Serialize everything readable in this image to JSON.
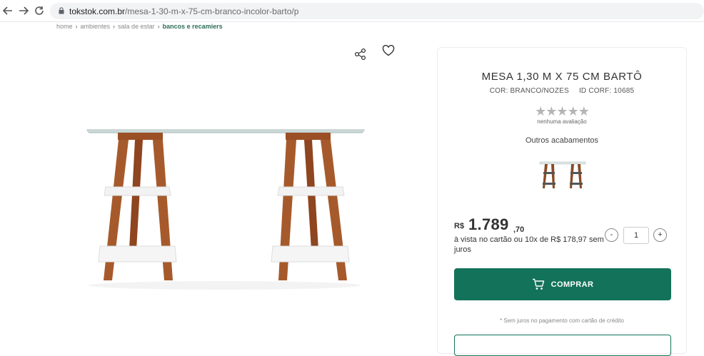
{
  "browser": {
    "url_domain": "tokstok.com.br",
    "url_path": "/mesa-1-30-m-x-75-cm-branco-incolor-barto/p"
  },
  "breadcrumb": {
    "items": [
      "home",
      "ambientes",
      "sala de estar"
    ],
    "current": "bancos e recamiers"
  },
  "product": {
    "title": "MESA 1,30 M X 75 CM BARTÔ",
    "color": "COR: BRANCO/NOZES",
    "id": "ID CORF: 10685",
    "stars": "★★★★★",
    "rating_text": "nenhuma avaliação",
    "finishes_label": "Outros acabamentos"
  },
  "price": {
    "currency": "R$",
    "main": "1.789",
    "cents": ",70",
    "installments": "à vista no cartão ou 10x de R$ 178,97 sem juros"
  },
  "quantity": {
    "minus": "-",
    "value": "1",
    "plus": "+"
  },
  "buy": {
    "label": "COMPRAR"
  },
  "disclaimer": "* Sem juros no pagamento com cartão de crédito",
  "colors": {
    "brand_green": "#13735a",
    "breadcrumb_current": "#2c6e55",
    "star_empty": "#b5b5b5"
  }
}
